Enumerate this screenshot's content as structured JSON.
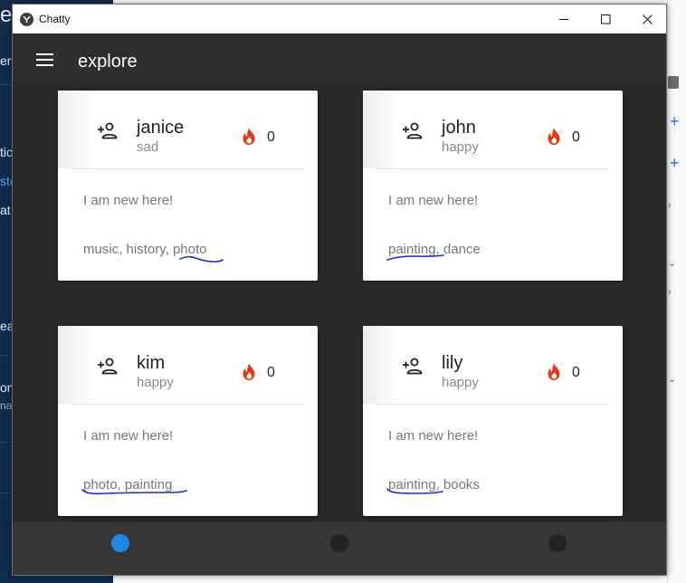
{
  "background": {
    "left_fragments": [
      "e",
      "erv",
      "tic",
      "sto",
      "at",
      "ea",
      "on",
      "na"
    ],
    "right_fragments": [
      "+",
      "+"
    ]
  },
  "window": {
    "title": "Chatty",
    "controls": [
      "minimize",
      "maximize",
      "close"
    ]
  },
  "appbar": {
    "title": "explore"
  },
  "cards": [
    {
      "name": "janice",
      "mood": "sad",
      "likes": "0",
      "bio": "I am new here!",
      "interests": [
        "music",
        "history",
        "photo"
      ]
    },
    {
      "name": "john",
      "mood": "happy",
      "likes": "0",
      "bio": "I am new here!",
      "interests": [
        "painting",
        "dance"
      ]
    },
    {
      "name": "kim",
      "mood": "happy",
      "likes": "0",
      "bio": "I am new here!",
      "interests": [
        "photo",
        "painting"
      ]
    },
    {
      "name": "lily",
      "mood": "happy",
      "likes": "0",
      "bio": "I am new here!",
      "interests": [
        "painting",
        "books"
      ]
    }
  ],
  "bottom_nav": {
    "active_index": 0,
    "count": 3
  },
  "colors": {
    "accent": "#1e88e5",
    "fire": "#e53a0f",
    "scribble": "#1a2bd6",
    "appbar": "#2e2e2e",
    "content_bg": "#282828"
  },
  "icons": {
    "add_friend": "person-add-icon",
    "likes": "fire-icon",
    "menu": "hamburger-menu-icon"
  }
}
